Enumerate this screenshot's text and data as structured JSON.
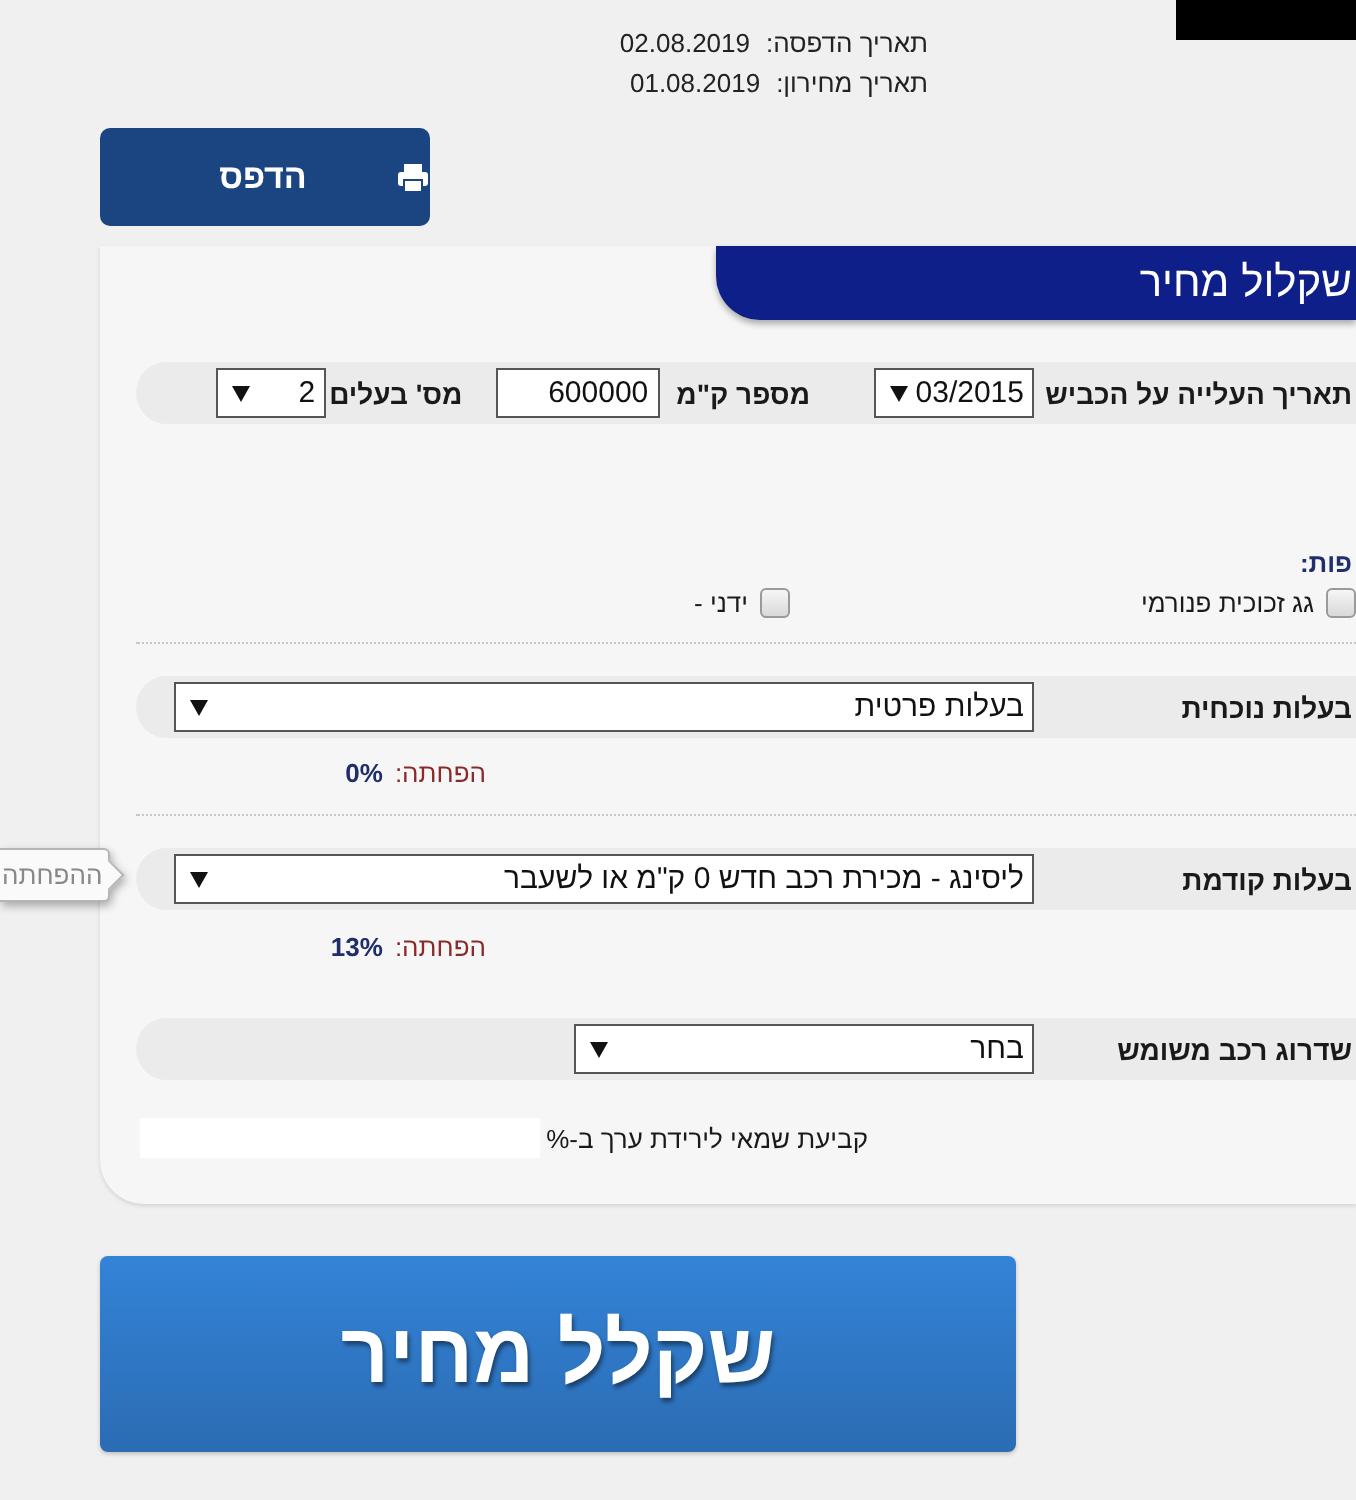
{
  "header": {
    "dates": [
      {
        "label": "תאריך הדפסה:",
        "value": "02.08.2019"
      },
      {
        "label": "תאריך מחירון:",
        "value": "01.08.2019"
      }
    ]
  },
  "print_button": {
    "label": "הדפס"
  },
  "panel": {
    "title": "שקלול מחיר",
    "vehicle_fields": [
      {
        "kind": "select",
        "label": "תאריך העלייה על הכביש",
        "value": "03/2015"
      },
      {
        "kind": "input",
        "label": "מספר ק\"מ",
        "value": "600000"
      },
      {
        "kind": "select",
        "label": "מס' בעלים",
        "value": "2"
      }
    ],
    "extras": {
      "heading": "פות:",
      "options": [
        {
          "label": "גג זכוכית פנורמי",
          "checked": false
        },
        {
          "label": "ידני -",
          "checked": false
        }
      ]
    },
    "ownership_rows": [
      {
        "label": "בעלות נוכחית",
        "value": "בעלות פרטית",
        "discount_label": "הפחתה:",
        "discount": "0%"
      },
      {
        "label": "בעלות קודמת",
        "value": "ליסינג - מכירת רכב חדש 0 ק\"מ או לשעבר",
        "discount_label": "הפחתה:",
        "discount": "13%"
      }
    ],
    "upgrade": {
      "label": "שדרוג רכב משומש",
      "value": "בחר"
    },
    "appraiser": {
      "label": "קביעת שמאי לירידת ערך ב-%"
    }
  },
  "tooltip": {
    "text": "ההפחתה"
  },
  "calculate_button": {
    "label": "שקלל מחיר"
  }
}
